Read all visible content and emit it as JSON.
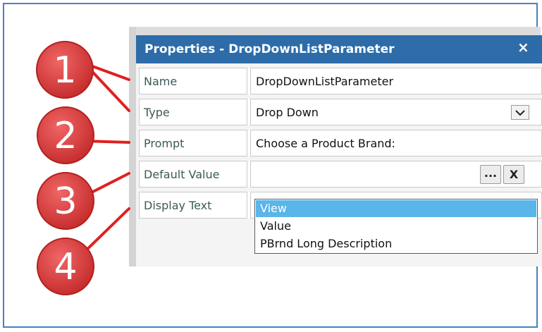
{
  "panel": {
    "title": "Properties - DropDownListParameter",
    "close_glyph": "×"
  },
  "rows": [
    {
      "label": "Name",
      "value": "DropDownListParameter"
    },
    {
      "label": "Type",
      "value": "Drop Down"
    },
    {
      "label": "Prompt",
      "value": "Choose a Product Brand:"
    },
    {
      "label": "Default Value",
      "value": ""
    },
    {
      "label": "Display Text",
      "value": ""
    }
  ],
  "default_value_buttons": {
    "browse": "...",
    "clear": "X"
  },
  "dropdown": {
    "options": [
      "View",
      "Value",
      "PBrnd Long Description"
    ],
    "selected_index": 0
  },
  "callouts": [
    "1",
    "2",
    "3",
    "4"
  ],
  "colors": {
    "titlebar": "#2d6ca8",
    "callout_red": "#d93a3a",
    "callout_line": "#e02020",
    "selection": "#5ab5e8",
    "frame": "#4a7fc1"
  }
}
